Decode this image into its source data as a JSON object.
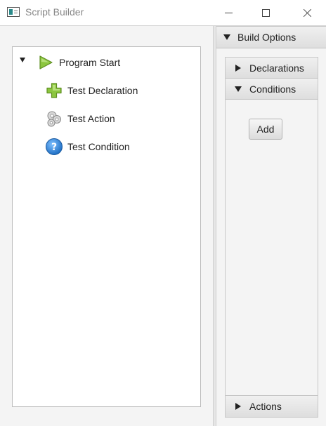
{
  "window": {
    "title": "Script Builder"
  },
  "tree": {
    "root": {
      "label": "Program Start",
      "icon": "play-icon",
      "expanded": true
    },
    "children": [
      {
        "label": "Test Declaration",
        "icon": "plus-icon"
      },
      {
        "label": "Test Action",
        "icon": "gears-icon"
      },
      {
        "label": "Test Condition",
        "icon": "question-icon"
      }
    ]
  },
  "build_options": {
    "title": "Build Options",
    "expanded": true,
    "sections": {
      "declarations": {
        "title": "Declarations",
        "expanded": false
      },
      "conditions": {
        "title": "Conditions",
        "expanded": true,
        "add_label": "Add"
      },
      "actions": {
        "title": "Actions",
        "expanded": false
      }
    }
  },
  "colors": {
    "play_green": "#8cc63f",
    "plus_green": "#8cc63f",
    "question_blue": "#2a7fd4"
  }
}
